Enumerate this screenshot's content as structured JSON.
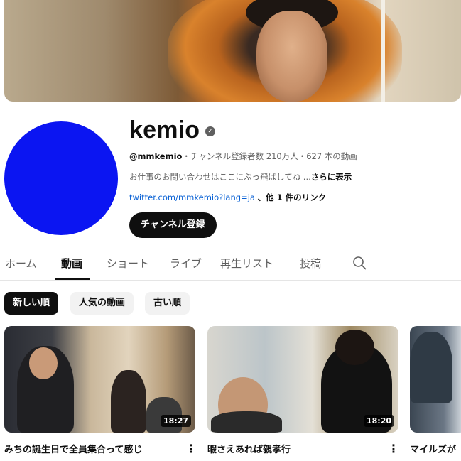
{
  "channel": {
    "name": "kemio",
    "handle": "@mmkemio",
    "stats": "・チャンネル登録者数 210万人・627 本の動画",
    "description": "お仕事のお問い合わせはここにぶっ飛ばしてね ...",
    "description_more": "さらに表示",
    "link_url": "twitter.com/mmkemio?lang=ja",
    "link_extra": "、他 1 件のリンク",
    "subscribe_label": "チャンネル登録",
    "avatar_color": "#0b15f2"
  },
  "tabs": [
    {
      "label": "ホーム"
    },
    {
      "label": "動画"
    },
    {
      "label": "ショート"
    },
    {
      "label": "ライブ"
    },
    {
      "label": "再生リスト"
    },
    {
      "label": "投稿"
    }
  ],
  "chips": [
    {
      "label": "新しい順"
    },
    {
      "label": "人気の動画"
    },
    {
      "label": "古い順"
    }
  ],
  "videos": [
    {
      "title": "みちの誕生日で全員集合って感じ",
      "duration": "18:27"
    },
    {
      "title": "暇さえあれば親孝行",
      "duration": "18:20"
    },
    {
      "title": "マイルズが"
    }
  ],
  "icons": {
    "verified": "verified-check-icon",
    "search": "search-icon",
    "more": "more-vert-icon"
  }
}
